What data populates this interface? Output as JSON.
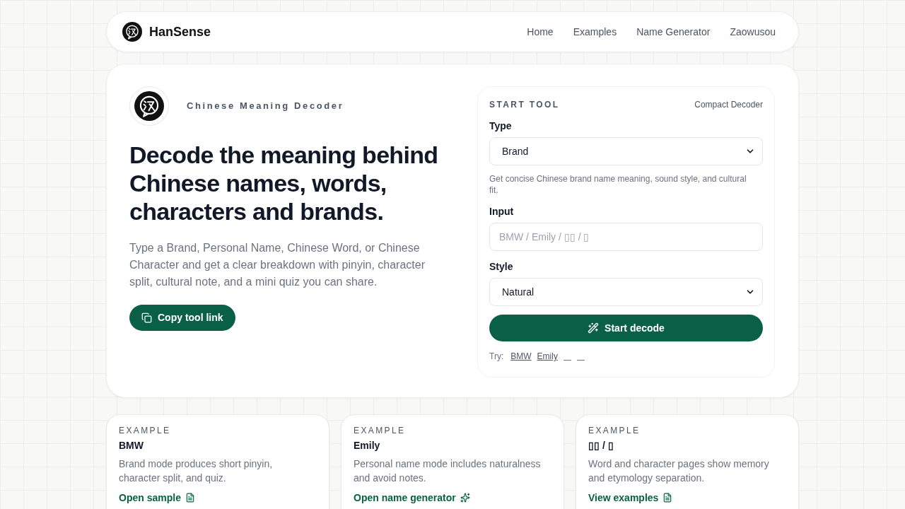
{
  "nav": {
    "brand": "HanSense",
    "links": [
      {
        "label": "Home"
      },
      {
        "label": "Examples"
      },
      {
        "label": "Name Generator"
      },
      {
        "label": "Zaowusou"
      }
    ]
  },
  "hero": {
    "eyebrow": "Chinese Meaning Decoder",
    "title": "Decode the meaning behind Chinese names, words, characters and brands.",
    "description": "Type a Brand, Personal Name, Chinese Word, or Chinese Character and get a clear breakdown with pinyin, character split, cultural note, and a mini quiz you can share.",
    "copy_button": "Copy tool link"
  },
  "tool": {
    "heading": "START TOOL",
    "mode": "Compact Decoder",
    "fields": [
      {
        "kind": "select",
        "label": "Type",
        "value": "Brand",
        "hint": "Get concise Chinese brand name meaning, sound style, and cultural fit."
      },
      {
        "kind": "input",
        "label": "Input",
        "placeholder": "BMW / Emily / ▯▯ / ▯"
      },
      {
        "kind": "select",
        "label": "Style",
        "value": "Natural"
      }
    ],
    "submit": "Start decode",
    "try": {
      "label": "Try:",
      "links": [
        {
          "kind": "text",
          "label": "BMW"
        },
        {
          "kind": "text",
          "label": "Emily"
        },
        {
          "kind": "blank"
        },
        {
          "kind": "blank"
        }
      ]
    }
  },
  "examples": [
    {
      "eyebrow": "EXAMPLE",
      "title": "BMW",
      "description": "Brand mode produces short pinyin, character split, and quiz.",
      "link": {
        "kind": "page",
        "label": "Open sample"
      }
    },
    {
      "eyebrow": "EXAMPLE",
      "title": "Emily",
      "description": "Personal name mode includes naturalness and avoid notes.",
      "link": {
        "kind": "tool",
        "label": "Open name generator"
      }
    },
    {
      "eyebrow": "EXAMPLE",
      "title": "▯▯ / ▯",
      "description": "Word and character pages show memory and etymology separation.",
      "link": {
        "kind": "page",
        "label": "View examples"
      }
    }
  ]
}
